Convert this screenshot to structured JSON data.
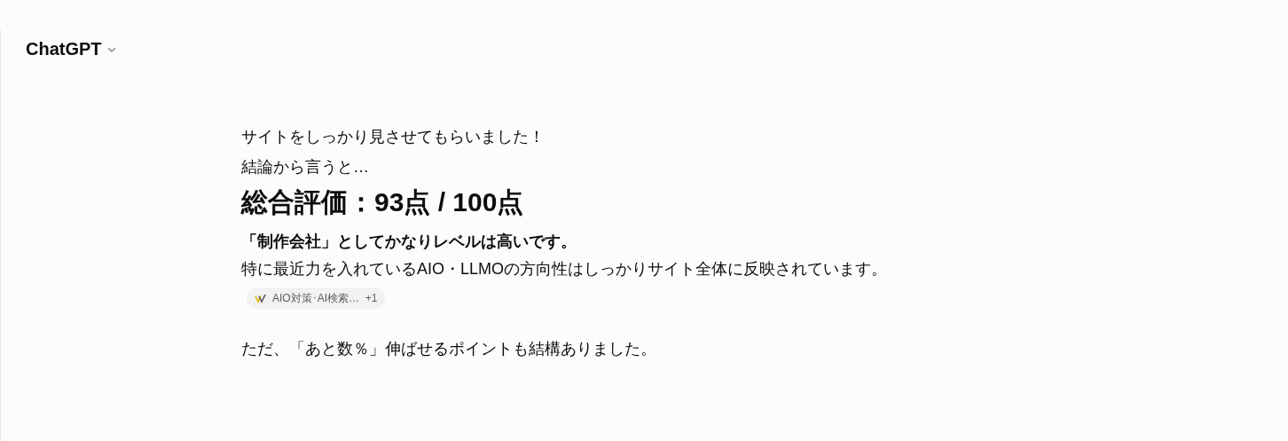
{
  "header": {
    "title": "ChatGPT"
  },
  "blocks": [
    {
      "kind": "text",
      "text": "サイトをしっかり見させてもらいました！"
    },
    {
      "kind": "text",
      "text": "結論から言うと…"
    },
    {
      "kind": "heading",
      "text": "総合評価：93点 / 100点"
    },
    {
      "kind": "strong",
      "text": "「制作会社」としてかなりレベルは高いです。"
    },
    {
      "kind": "text",
      "text": "特に最近力を入れているAIO・LLMOの方向性はしっかりサイト全体に反映されています。"
    },
    {
      "kind": "citation",
      "text": "AIO対策･AI検索…",
      "count": "+1"
    },
    {
      "kind": "text",
      "text": "ただ、「あと数％」伸ばせるポイントも結構ありました。"
    }
  ]
}
